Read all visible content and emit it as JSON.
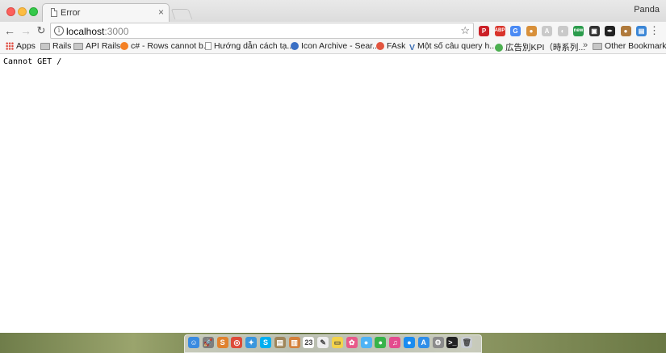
{
  "window": {
    "profile_name": "Panda"
  },
  "tab": {
    "title": "Error",
    "close_glyph": "×"
  },
  "toolbar": {
    "back_glyph": "←",
    "forward_glyph": "→",
    "reload_glyph": "↻",
    "url_host": "localhost",
    "url_port": ":3000",
    "info_glyph": "i",
    "star_glyph": "☆",
    "menu_glyph": "⋮",
    "extensions": [
      {
        "name": "pinterest-icon",
        "color": "#cb2027",
        "glyph": "P"
      },
      {
        "name": "adblock-icon",
        "color": "#d9342b",
        "glyph": "ABP"
      },
      {
        "name": "translate-icon",
        "color": "#4a8af4",
        "glyph": "G"
      },
      {
        "name": "cookie-icon",
        "color": "#d8903a",
        "glyph": "●"
      },
      {
        "name": "extension-gray-icon",
        "color": "#c9c9c9",
        "glyph": "A"
      },
      {
        "name": "extension-gray2-icon",
        "color": "#c9c9c9",
        "glyph": "◐"
      },
      {
        "name": "new-badge-icon",
        "color": "#2b9c4c",
        "glyph": "new"
      },
      {
        "name": "image-extension-icon",
        "color": "#333333",
        "glyph": "▣"
      },
      {
        "name": "feather-icon",
        "color": "#222222",
        "glyph": "✒"
      },
      {
        "name": "color-dot-icon",
        "color": "#b07a3c",
        "glyph": "●"
      },
      {
        "name": "screenshot-icon",
        "color": "#3b86d6",
        "glyph": "▤"
      }
    ]
  },
  "bookmarks": {
    "items": [
      {
        "label": "Apps"
      },
      {
        "label": "Rails"
      },
      {
        "label": "API Rails"
      },
      {
        "label": "c# - Rows cannot b..."
      },
      {
        "label": "Hướng dẫn cách tạ..."
      },
      {
        "label": "Icon Archive - Sear..."
      },
      {
        "label": "FAsk"
      },
      {
        "label": "Một số câu query h..."
      },
      {
        "label": "広告別KPI（時系列..."
      }
    ],
    "overflow_glyph": "»",
    "other_bookmarks": "Other Bookmarks"
  },
  "content": {
    "message": "Cannot GET /"
  },
  "dock": {
    "apps": [
      {
        "name": "finder-icon",
        "color": "#3a8be0",
        "glyph": "☺"
      },
      {
        "name": "launchpad-icon",
        "color": "#7d7d7d",
        "glyph": "🚀"
      },
      {
        "name": "sublime-icon",
        "color": "#e0822f",
        "glyph": "S"
      },
      {
        "name": "chrome-icon",
        "color": "#dd4b39",
        "glyph": "◎"
      },
      {
        "name": "safari-icon",
        "color": "#3a96dd",
        "glyph": "✦"
      },
      {
        "name": "skype-icon",
        "color": "#00aff0",
        "glyph": "S"
      },
      {
        "name": "notes-icon",
        "color": "#a0865a",
        "glyph": "▤"
      },
      {
        "name": "sequel-icon",
        "color": "#d4813c",
        "glyph": "▥"
      },
      {
        "name": "calendar-icon",
        "color": "#ffffff",
        "glyph": "23"
      },
      {
        "name": "textedit-icon",
        "color": "#eeeeee",
        "glyph": "✎"
      },
      {
        "name": "stickies-icon",
        "color": "#f3d34a",
        "glyph": "▭"
      },
      {
        "name": "photos-icon",
        "color": "#e85a8a",
        "glyph": "✿"
      },
      {
        "name": "messages-icon",
        "color": "#4fb3f4",
        "glyph": "●"
      },
      {
        "name": "wechat-icon",
        "color": "#37b34a",
        "glyph": "●"
      },
      {
        "name": "itunes-icon",
        "color": "#e34c8e",
        "glyph": "♫"
      },
      {
        "name": "messenger-icon",
        "color": "#1a8cf0",
        "glyph": "●"
      },
      {
        "name": "appstore-icon",
        "color": "#2f8ee8",
        "glyph": "A"
      },
      {
        "name": "settings-icon",
        "color": "#8b8b8b",
        "glyph": "⚙"
      },
      {
        "name": "terminal-icon",
        "color": "#222222",
        "glyph": ">_"
      },
      {
        "name": "trash-icon",
        "color": "#c9cdd2",
        "glyph": "🗑"
      }
    ]
  }
}
